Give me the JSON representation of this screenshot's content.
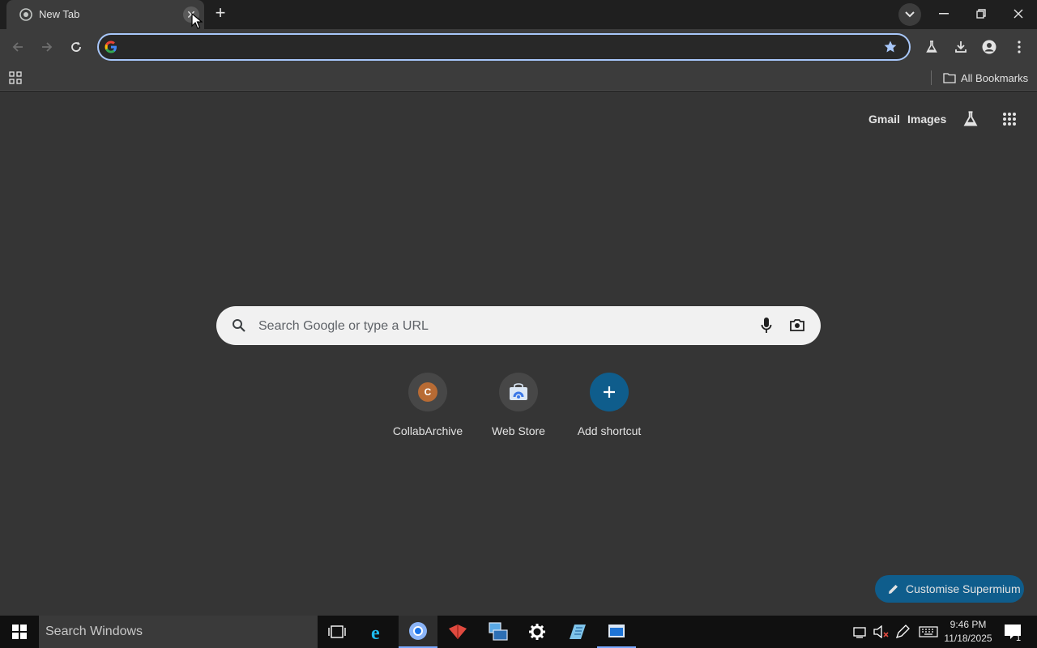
{
  "tab": {
    "title": "New Tab",
    "close_icon": "close-icon"
  },
  "window_controls": [
    "minimize-icon",
    "restore-icon",
    "close-icon"
  ],
  "toolbar": {
    "omnibox_value": "",
    "omnibox_placeholder": ""
  },
  "bookmarks_bar": {
    "all_bookmarks_label": "All Bookmarks"
  },
  "ntp": {
    "links": {
      "gmail": "Gmail",
      "images": "Images"
    },
    "search_placeholder": "Search Google or type a URL",
    "shortcuts": [
      {
        "label": "CollabArchive",
        "letter": "C",
        "letter_bg": "#b86b34"
      },
      {
        "label": "Web Store"
      },
      {
        "label": "Add shortcut"
      }
    ],
    "customise_label": "Customise Supermium"
  },
  "taskbar": {
    "search_label": "Search Windows",
    "time": "9:46 PM",
    "date": "11/18/2025",
    "notification_count": "1"
  },
  "colors": {
    "accent": "#a8c7fa",
    "page_bg": "#353535",
    "toolbar_bg": "#3c3c3c",
    "customise_bg": "#0f5d8c",
    "add_shortcut_bg": "#0f5d8c"
  }
}
